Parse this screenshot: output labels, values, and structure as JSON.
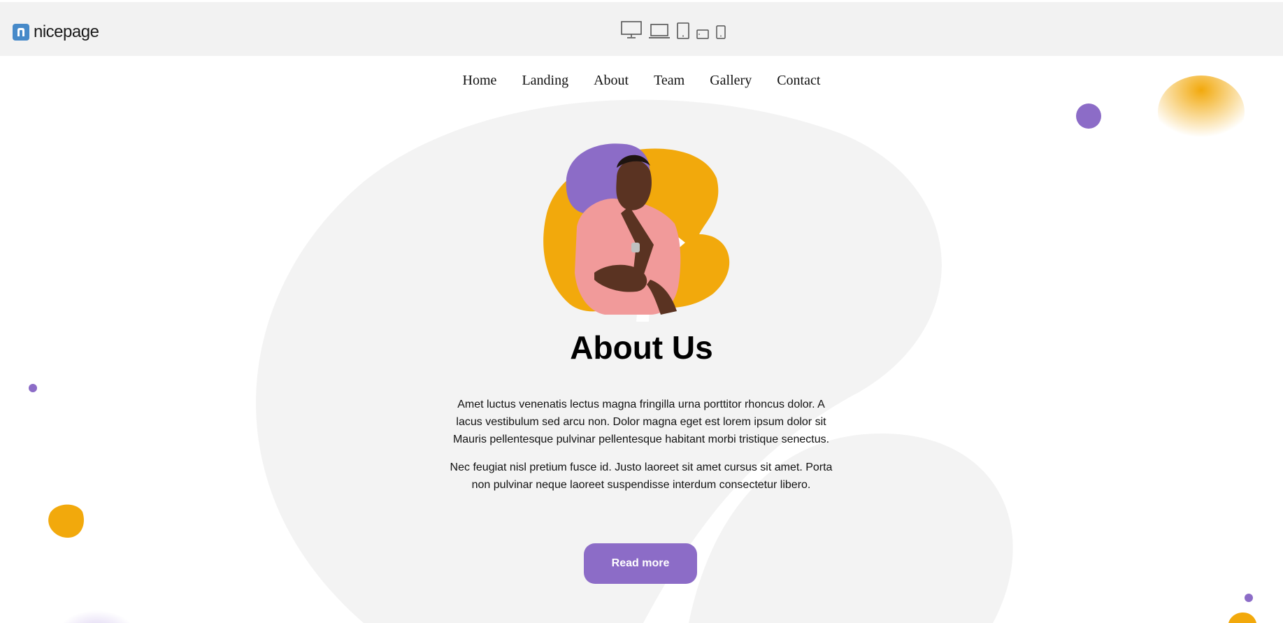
{
  "app": {
    "logo_text": "nicepage"
  },
  "device_preview": [
    "desktop-icon",
    "laptop-icon",
    "tablet-icon",
    "tablet-landscape-icon",
    "phone-icon"
  ],
  "nav": {
    "items": [
      "Home",
      "Landing",
      "About",
      "Team",
      "Gallery",
      "Contact"
    ]
  },
  "hero": {
    "title": "About Us",
    "paragraph_1": "Amet luctus venenatis lectus magna fringilla urna porttitor rhoncus dolor. A lacus vestibulum sed arcu non. Dolor magna eget est lorem ipsum dolor sit Mauris pellentesque pulvinar pellentesque habitant morbi tristique senectus.",
    "paragraph_2": "Nec feugiat nisl pretium fusce id. Justo laoreet sit amet cursus sit amet. Porta non pulvinar neque laoreet suspendisse interdum consectetur libero.",
    "button_label": "Read more"
  },
  "colors": {
    "purple": "#8c6cc7",
    "orange": "#f2a90c",
    "logo_blue": "#478ac9",
    "bg_shape": "#f3f3f3"
  }
}
